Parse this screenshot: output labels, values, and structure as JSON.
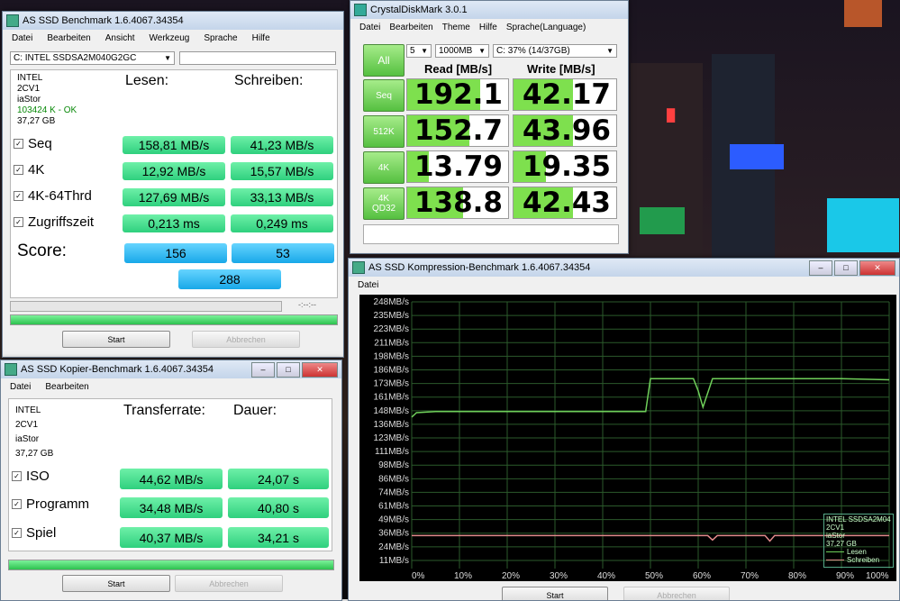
{
  "as_main": {
    "title": "AS SSD Benchmark 1.6.4067.34354",
    "menu": [
      "Datei",
      "Bearbeiten",
      "Ansicht",
      "Werkzeug",
      "Sprache",
      "Hilfe"
    ],
    "drive_select": "C: INTEL SSDSA2M040G2GC",
    "info": [
      "INTEL",
      "2CV1",
      "iaStor",
      "103424 K - OK",
      "37,27 GB"
    ],
    "col_read": "Lesen:",
    "col_write": "Schreiben:",
    "rows": [
      {
        "label": "Seq",
        "read": "158,81 MB/s",
        "write": "41,23 MB/s"
      },
      {
        "label": "4K",
        "read": "12,92 MB/s",
        "write": "15,57 MB/s"
      },
      {
        "label": "4K-64Thrd",
        "read": "127,69 MB/s",
        "write": "33,13 MB/s"
      },
      {
        "label": "Zugriffszeit",
        "read": "0,213 ms",
        "write": "0,249 ms"
      }
    ],
    "score_label": "Score:",
    "score_read": "156",
    "score_write": "53",
    "score_total": "288",
    "time_placeholder": "-:--:--",
    "start": "Start",
    "abort": "Abbrechen",
    "progress": 1.0
  },
  "as_copy": {
    "title": "AS SSD Kopier-Benchmark 1.6.4067.34354",
    "menu": [
      "Datei",
      "Bearbeiten"
    ],
    "info": [
      "INTEL",
      "2CV1",
      "iaStor",
      "37,27 GB"
    ],
    "col_rate": "Transferrate:",
    "col_duration": "Dauer:",
    "rows": [
      {
        "label": "ISO",
        "rate": "44,62 MB/s",
        "duration": "24,07 s"
      },
      {
        "label": "Programm",
        "rate": "34,48 MB/s",
        "duration": "40,80 s"
      },
      {
        "label": "Spiel",
        "rate": "40,37 MB/s",
        "duration": "34,21 s"
      }
    ],
    "start": "Start",
    "abort": "Abbrechen",
    "progress": 1.0
  },
  "cdm": {
    "title": "CrystalDiskMark 3.0.1",
    "menu": [
      "Datei",
      "Bearbeiten",
      "Theme",
      "Hilfe",
      "Sprache(Language)"
    ],
    "all": "All",
    "runs": "5",
    "size": "1000MB",
    "drive": "C: 37% (14/37GB)",
    "head_read": "Read [MB/s]",
    "head_write": "Write [MB/s]",
    "rows": [
      {
        "label": "Seq",
        "label2": "",
        "read": "192.1",
        "write": "42.17",
        "read_frac": 0.72,
        "write_frac": 0.58
      },
      {
        "label": "512K",
        "label2": "",
        "read": "152.7",
        "write": "43.96",
        "read_frac": 0.62,
        "write_frac": 0.58
      },
      {
        "label": "4K",
        "label2": "",
        "read": "13.79",
        "write": "19.35",
        "read_frac": 0.21,
        "write_frac": 0.32
      },
      {
        "label": "4K",
        "label2": "QD32",
        "read": "138.8",
        "write": "42.43",
        "read_frac": 0.55,
        "write_frac": 0.58
      }
    ]
  },
  "comp": {
    "title": "AS SSD Kompression-Benchmark 1.6.4067.34354",
    "menu": [
      "Datei"
    ],
    "start": "Start",
    "abort": "Abbrechen",
    "legend": {
      "lines": [
        "INTEL SSDSA2M04",
        "2CV1",
        "iaStor",
        "37,27 GB"
      ],
      "read": "Lesen",
      "write": "Schreiben"
    }
  },
  "chart_data": {
    "type": "line",
    "ylabels": [
      "248MB/s",
      "235MB/s",
      "223MB/s",
      "211MB/s",
      "198MB/s",
      "186MB/s",
      "173MB/s",
      "161MB/s",
      "148MB/s",
      "136MB/s",
      "123MB/s",
      "111MB/s",
      "98MB/s",
      "86MB/s",
      "74MB/s",
      "61MB/s",
      "49MB/s",
      "36MB/s",
      "24MB/s",
      "11MB/s"
    ],
    "xlabels": [
      "0%",
      "10%",
      "20%",
      "30%",
      "40%",
      "50%",
      "60%",
      "70%",
      "80%",
      "90%",
      "100%"
    ],
    "ylim": [
      0,
      255
    ],
    "series": [
      {
        "name": "Lesen",
        "color": "#6fcf5a",
        "x": [
          0,
          1,
          5,
          10,
          20,
          30,
          40,
          48,
          49,
          50,
          55,
          57,
          59,
          60,
          61,
          63,
          70,
          80,
          90,
          100
        ],
        "y": [
          143,
          147,
          148,
          148,
          148,
          148,
          148,
          148,
          148,
          178,
          178,
          178,
          178,
          167,
          152,
          178,
          178,
          178,
          178,
          177
        ]
      },
      {
        "name": "Schreiben",
        "color": "#e08a8a",
        "x": [
          0,
          10,
          20,
          30,
          40,
          50,
          60,
          62,
          63,
          64,
          70,
          74,
          75,
          76,
          80,
          90,
          100
        ],
        "y": [
          35,
          35,
          35,
          35,
          35,
          35,
          35,
          35,
          31,
          35,
          35,
          35,
          30,
          35,
          35,
          35,
          35
        ]
      }
    ],
    "grid": true
  }
}
